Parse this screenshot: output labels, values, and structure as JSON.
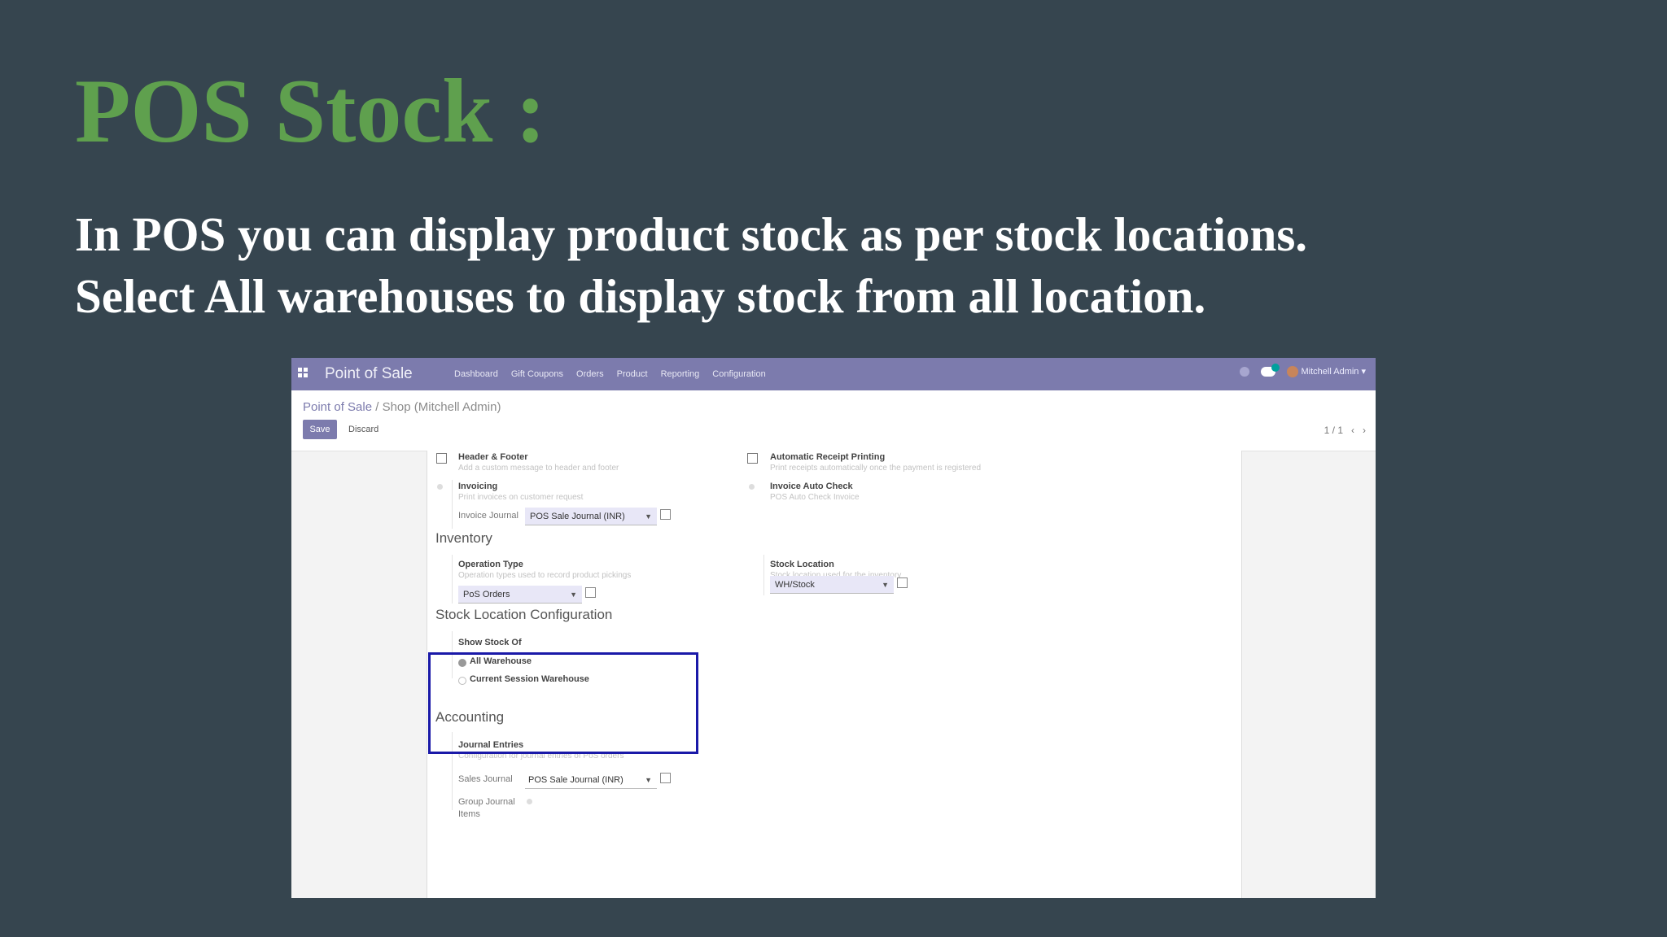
{
  "slide": {
    "title": "POS Stock :",
    "line1": "In POS you can display product stock as per stock locations.",
    "line2": "Select All warehouses to display stock from all location."
  },
  "navbar": {
    "brand": "Point of Sale",
    "menu": [
      "Dashboard",
      "Gift Coupons",
      "Orders",
      "Product",
      "Reporting",
      "Configuration"
    ],
    "chat_count": "1",
    "user": "Mitchell Admin"
  },
  "breadcrumb": {
    "root": "Point of Sale",
    "separator": " / ",
    "current": "Shop (Mitchell Admin)"
  },
  "buttons": {
    "save": "Save",
    "discard": "Discard"
  },
  "pager": {
    "value": "1 / 1"
  },
  "form": {
    "header_footer": {
      "label": "Header & Footer",
      "help": "Add a custom message to header and footer"
    },
    "auto_receipt": {
      "label": "Automatic Receipt Printing",
      "help": "Print receipts automatically once the payment is registered"
    },
    "invoicing": {
      "label": "Invoicing",
      "help": "Print invoices on customer request"
    },
    "invoice_auto_check": {
      "label": "Invoice Auto Check",
      "help": "POS Auto Check Invoice"
    },
    "invoice_journal": {
      "label": "Invoice Journal",
      "value": "POS Sale Journal (INR)"
    },
    "inventory": {
      "title": "Inventory",
      "operation_type": {
        "label": "Operation Type",
        "help": "Operation types used to record product pickings",
        "value": "PoS Orders"
      },
      "stock_location": {
        "label": "Stock Location",
        "help": "Stock location used for the inventory",
        "value": "WH/Stock"
      }
    },
    "stock_config": {
      "title": "Stock Location Configuration",
      "show_stock_label": "Show Stock Of",
      "options": [
        "All Warehouse",
        "Current Session Warehouse"
      ],
      "selected": "All Warehouse"
    },
    "accounting": {
      "title": "Accounting",
      "journal_entries": {
        "label": "Journal Entries",
        "help": "Configuration for journal entries of PoS orders"
      },
      "sales_journal": {
        "label": "Sales Journal",
        "value": "POS Sale Journal (INR)"
      },
      "group_journal": {
        "label1": "Group Journal",
        "label2": "Items"
      }
    }
  },
  "colors": {
    "background": "#36454f",
    "title_green": "#5fa04e",
    "navbar": "#7c7bad",
    "highlight": "#1a19a8"
  }
}
